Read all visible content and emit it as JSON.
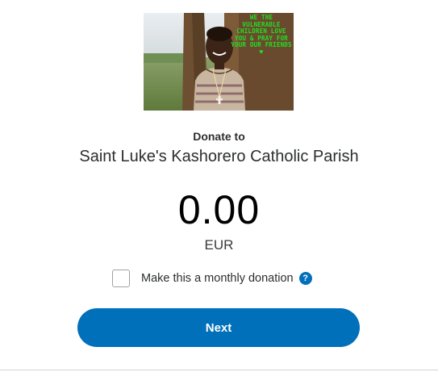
{
  "hero": {
    "caption": "WE THE VULNERABLE CHILDREN LOVE YOU & PRAY FOR YOUR OUR FRIENDS ♥"
  },
  "donation": {
    "heading": "Donate to",
    "organization": "Saint Luke's Kashorero Catholic Parish",
    "amount": "0.00",
    "currency": "EUR"
  },
  "monthly": {
    "label": "Make this a monthly donation",
    "checked": false,
    "help_icon_text": "?"
  },
  "actions": {
    "next_label": "Next"
  },
  "colors": {
    "primary": "#0070ba",
    "text": "#2c2e2f",
    "caption_green": "#21e021"
  }
}
